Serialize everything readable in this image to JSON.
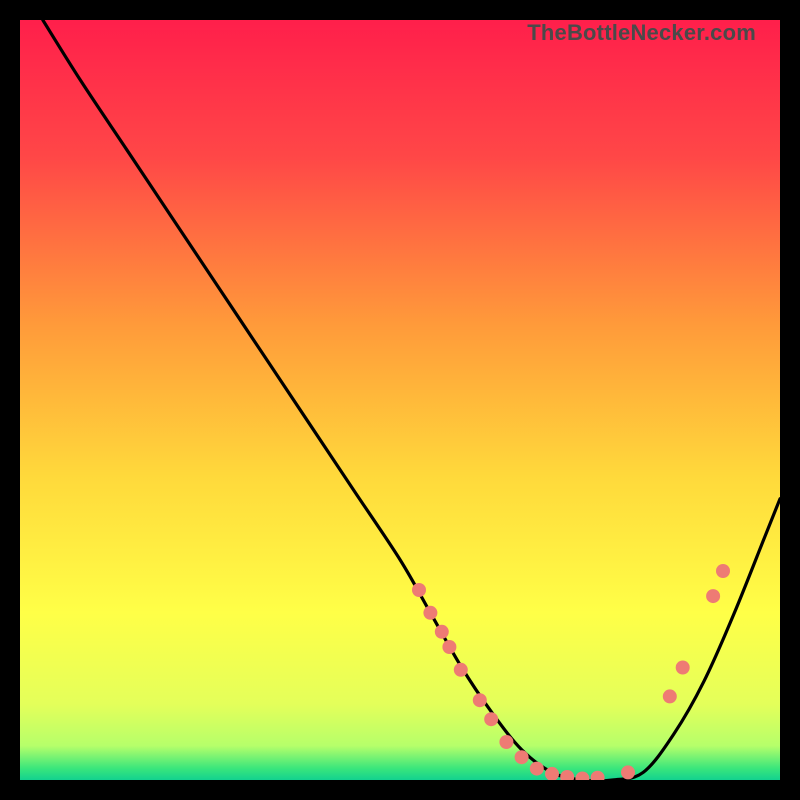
{
  "watermark": "TheBottleNecker.com",
  "chart_data": {
    "type": "line",
    "title": "",
    "xlabel": "",
    "ylabel": "",
    "xlim": [
      0,
      100
    ],
    "ylim": [
      0,
      100
    ],
    "grid": false,
    "legend": false,
    "gradient_stops": [
      {
        "offset": 0.0,
        "color": "#ff1f4b"
      },
      {
        "offset": 0.18,
        "color": "#ff4747"
      },
      {
        "offset": 0.4,
        "color": "#ff9a3a"
      },
      {
        "offset": 0.6,
        "color": "#ffd93b"
      },
      {
        "offset": 0.78,
        "color": "#ffff47"
      },
      {
        "offset": 0.9,
        "color": "#e4ff5a"
      },
      {
        "offset": 0.955,
        "color": "#b6ff6a"
      },
      {
        "offset": 0.985,
        "color": "#39e67c"
      },
      {
        "offset": 1.0,
        "color": "#12d18f"
      }
    ],
    "series": [
      {
        "name": "bottleneck-curve",
        "color": "#000000",
        "x": [
          3,
          8,
          14,
          20,
          26,
          32,
          38,
          44,
          50,
          54,
          58,
          62,
          66,
          70,
          74,
          78,
          82,
          86,
          90,
          94,
          98,
          100
        ],
        "y": [
          100,
          92,
          83,
          74,
          65,
          56,
          47,
          38,
          29,
          22,
          15,
          9,
          4,
          1,
          0,
          0,
          1,
          6,
          13,
          22,
          32,
          37
        ]
      }
    ],
    "markers": {
      "name": "curve-dots",
      "color": "#ee7b74",
      "radius": 7,
      "points": [
        {
          "x": 52.5,
          "y": 25
        },
        {
          "x": 54.0,
          "y": 22
        },
        {
          "x": 55.5,
          "y": 19.5
        },
        {
          "x": 56.5,
          "y": 17.5
        },
        {
          "x": 58.0,
          "y": 14.5
        },
        {
          "x": 60.5,
          "y": 10.5
        },
        {
          "x": 62.0,
          "y": 8
        },
        {
          "x": 64.0,
          "y": 5
        },
        {
          "x": 66.0,
          "y": 3
        },
        {
          "x": 68.0,
          "y": 1.5
        },
        {
          "x": 70.0,
          "y": 0.8
        },
        {
          "x": 72.0,
          "y": 0.4
        },
        {
          "x": 74.0,
          "y": 0.2
        },
        {
          "x": 76.0,
          "y": 0.3
        },
        {
          "x": 80.0,
          "y": 1.0
        },
        {
          "x": 85.5,
          "y": 11
        },
        {
          "x": 87.2,
          "y": 14.8
        },
        {
          "x": 91.2,
          "y": 24.2
        },
        {
          "x": 92.5,
          "y": 27.5
        }
      ]
    }
  }
}
